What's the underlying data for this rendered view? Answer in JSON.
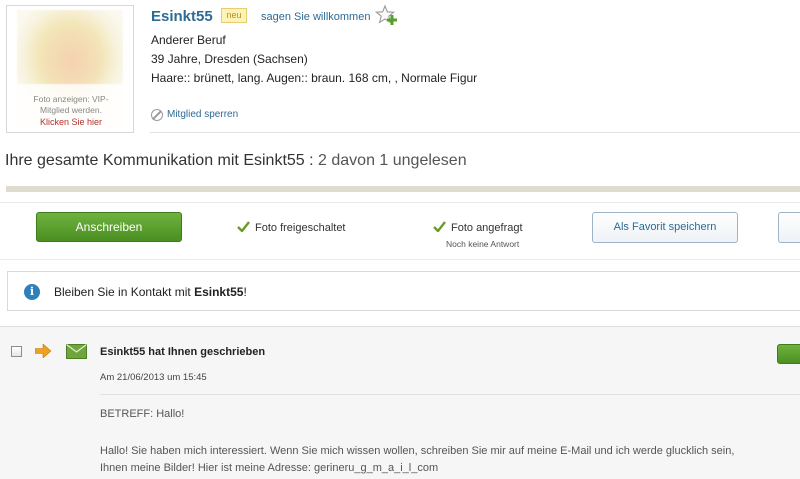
{
  "profile": {
    "username": "Esinkt55",
    "new_badge": "neu",
    "greet_link": "sagen Sie willkommen",
    "occupation": "Anderer Beruf",
    "age_location": "39 Jahre, Dresden (Sachsen)",
    "appearance": "Haare:: brünett, lang. Augen:: braun. 168 cm, , Normale Figur",
    "photo_note": "Foto anzeigen: VIP-Mitglied werden.",
    "photo_link": "Klicken Sie hier",
    "block_link": "Mitglied sperren"
  },
  "communication": {
    "title": "Ihre gesamte Kommunikation mit Esinkt55 :",
    "count": "2 davon 1 ungelesen"
  },
  "actions": {
    "write_button": "Anschreiben",
    "photo_released": "Foto freigeschaltet",
    "photo_requested": "Foto angefragt",
    "photo_requested_sub": "Noch keine Antwort",
    "favorite_button": "Als Favorit speichern"
  },
  "notice": {
    "prefix": "Bleiben Sie in Kontakt mit ",
    "name": "Esinkt55",
    "suffix": "!"
  },
  "message": {
    "title": "Esinkt55 hat Ihnen geschrieben",
    "date": "Am 21/06/2013 um 15:45",
    "subject": "BETREFF: Hallo!",
    "body_line1": "Hallo! Sie haben mich interessiert. Wenn Sie mich wissen wollen, schreiben Sie mir auf meine E-Mail und ich werde glucklich sein,",
    "body_line2": "Ihnen meine Bilder! Hier ist meine Adresse: gerineru_g_m_a_i_l_com"
  },
  "colors": {
    "link": "#2d6b94",
    "green_button": "#5aa02c",
    "check": "#6a9a2a",
    "arrow": "#f0a020"
  }
}
